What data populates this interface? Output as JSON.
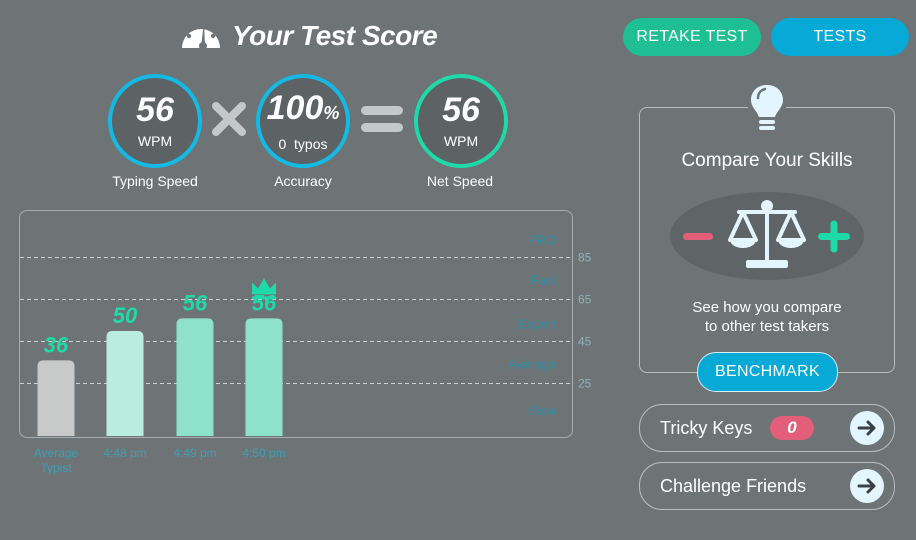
{
  "header": {
    "title": "Your Test Score",
    "retake_label": "RETAKE TEST",
    "tests_label": "TESTS"
  },
  "scores": {
    "typing_speed": {
      "value": "56",
      "unit": "WPM",
      "label": "Typing Speed"
    },
    "accuracy": {
      "value": "100",
      "suffix": "%",
      "sub_count": "0",
      "sub_unit": "typos",
      "label": "Accuracy"
    },
    "net_speed": {
      "value": "56",
      "unit": "WPM",
      "label": "Net Speed"
    },
    "multiply_icon": "multiply-icon",
    "equals_icon": "equals-icon"
  },
  "chart_data": {
    "type": "bar",
    "categories": [
      "Average Typist",
      "4:48 pm",
      "4:49 pm",
      "4:50 pm"
    ],
    "values": [
      36,
      50,
      56,
      56
    ],
    "ylim": [
      0,
      100
    ],
    "gridlines": [
      25,
      45,
      65,
      85
    ],
    "levels": [
      {
        "label": "PRO",
        "value": 93
      },
      {
        "label": "Fast",
        "value": 74
      },
      {
        "label": "Expert",
        "value": 53
      },
      {
        "label": "Average",
        "value": 34
      },
      {
        "label": "Slow",
        "value": 12
      }
    ],
    "bar_colors": [
      "#c8c9c9",
      "#b9eddf",
      "#8ee2cc",
      "#8ee2cc"
    ],
    "best_index": 3
  },
  "compare": {
    "title": "Compare Your Skills",
    "desc_line1": "See how you compare",
    "desc_line2": "to other test takers",
    "benchmark_label": "BENCHMARK"
  },
  "tricky": {
    "label": "Tricky Keys",
    "count": "0"
  },
  "challenge": {
    "label": "Challenge Friends"
  },
  "colors": {
    "blue": "#07a9d6",
    "green": "#1fbf95",
    "teal": "#20d9a8",
    "pink": "#e35f79"
  }
}
